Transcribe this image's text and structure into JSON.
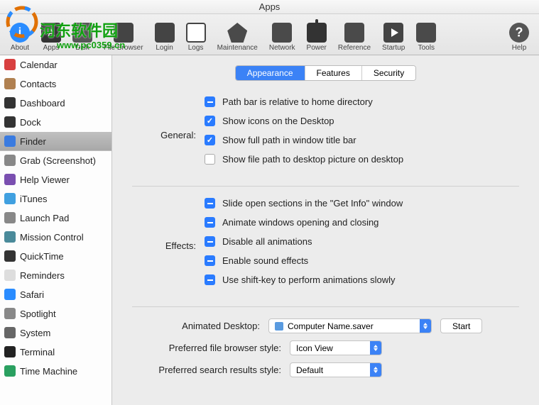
{
  "window": {
    "title": "Apps"
  },
  "toolbar": [
    {
      "id": "about",
      "label": "About"
    },
    {
      "id": "apps",
      "label": "Apps"
    },
    {
      "id": "disk",
      "label": "Disk"
    },
    {
      "id": "file-browser",
      "label": "File Browser"
    },
    {
      "id": "login",
      "label": "Login"
    },
    {
      "id": "logs",
      "label": "Logs"
    },
    {
      "id": "maintenance",
      "label": "Maintenance"
    },
    {
      "id": "network",
      "label": "Network"
    },
    {
      "id": "power",
      "label": "Power"
    },
    {
      "id": "reference",
      "label": "Reference"
    },
    {
      "id": "startup",
      "label": "Startup"
    },
    {
      "id": "tools",
      "label": "Tools"
    }
  ],
  "help_label": "Help",
  "sidebar": {
    "items": [
      {
        "label": "Calendar",
        "color": "#d84040"
      },
      {
        "label": "Contacts",
        "color": "#b08050"
      },
      {
        "label": "Dashboard",
        "color": "#333"
      },
      {
        "label": "Dock",
        "color": "#333"
      },
      {
        "label": "Finder",
        "color": "#3a7be0",
        "selected": true
      },
      {
        "label": "Grab (Screenshot)",
        "color": "#888"
      },
      {
        "label": "Help Viewer",
        "color": "#7a4fb0"
      },
      {
        "label": "iTunes",
        "color": "#40a0e0"
      },
      {
        "label": "Launch Pad",
        "color": "#888"
      },
      {
        "label": "Mission Control",
        "color": "#4a8a9a"
      },
      {
        "label": "QuickTime",
        "color": "#333"
      },
      {
        "label": "Reminders",
        "color": "#ddd"
      },
      {
        "label": "Safari",
        "color": "#2a8cff"
      },
      {
        "label": "Spotlight",
        "color": "#888"
      },
      {
        "label": "System",
        "color": "#666"
      },
      {
        "label": "Terminal",
        "color": "#222"
      },
      {
        "label": "Time Machine",
        "color": "#2aa060"
      }
    ]
  },
  "tabs": [
    {
      "label": "Appearance",
      "active": true
    },
    {
      "label": "Features",
      "active": false
    },
    {
      "label": "Security",
      "active": false
    }
  ],
  "sections": {
    "general": {
      "label": "General:",
      "options": [
        {
          "state": "mixed",
          "text": "Path bar is relative to home directory"
        },
        {
          "state": "checked",
          "text": "Show icons on the Desktop"
        },
        {
          "state": "checked",
          "text": "Show full path in window title bar"
        },
        {
          "state": "unchecked",
          "text": "Show file path to desktop picture on desktop"
        }
      ]
    },
    "effects": {
      "label": "Effects:",
      "options": [
        {
          "state": "mixed",
          "text": "Slide open sections in the \"Get Info\" window"
        },
        {
          "state": "mixed",
          "text": "Animate windows opening and closing"
        },
        {
          "state": "mixed",
          "text": "Disable all animations"
        },
        {
          "state": "mixed",
          "text": "Enable sound effects"
        },
        {
          "state": "mixed",
          "text": "Use shift-key to perform animations slowly"
        }
      ]
    }
  },
  "dropdowns": {
    "animated_desktop": {
      "label": "Animated Desktop:",
      "value": "Computer Name.saver",
      "button": "Start"
    },
    "file_browser": {
      "label": "Preferred file browser style:",
      "value": "Icon View"
    },
    "search_results": {
      "label": "Preferred search results style:",
      "value": "Default"
    }
  },
  "watermark": {
    "text": "河东软件园",
    "url": "www.pc0359.cn"
  }
}
